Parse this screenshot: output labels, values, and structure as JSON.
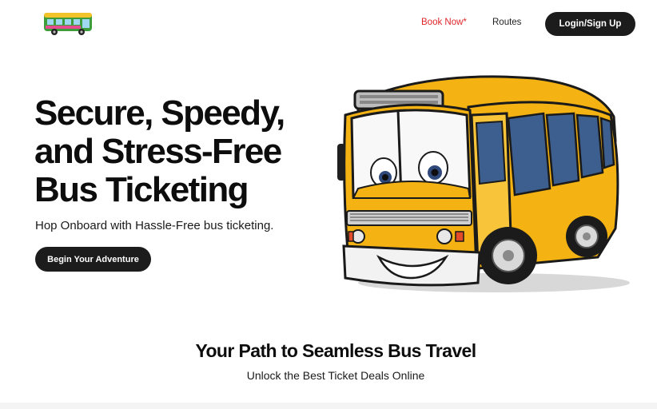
{
  "nav": {
    "logo_icon": "bus-logo-icon",
    "book_now": "Book Now*",
    "routes": "Routes",
    "login": "Login/Sign Up"
  },
  "hero": {
    "title_line1": "Secure, Speedy,",
    "title_line2": "and Stress-Free",
    "title_line3": "Bus Ticketing",
    "subtitle": "Hop Onboard with Hassle-Free bus ticketing.",
    "cta": "Begin Your Adventure",
    "illustration_icon": "cartoon-bus-illustration"
  },
  "section": {
    "title": "Your Path to Seamless Bus Travel",
    "subtitle": "Unlock the Best Ticket Deals Online"
  },
  "colors": {
    "accent_red": "#e0262a",
    "button_dark": "#1c1c1c",
    "bus_yellow": "#f4b313"
  }
}
